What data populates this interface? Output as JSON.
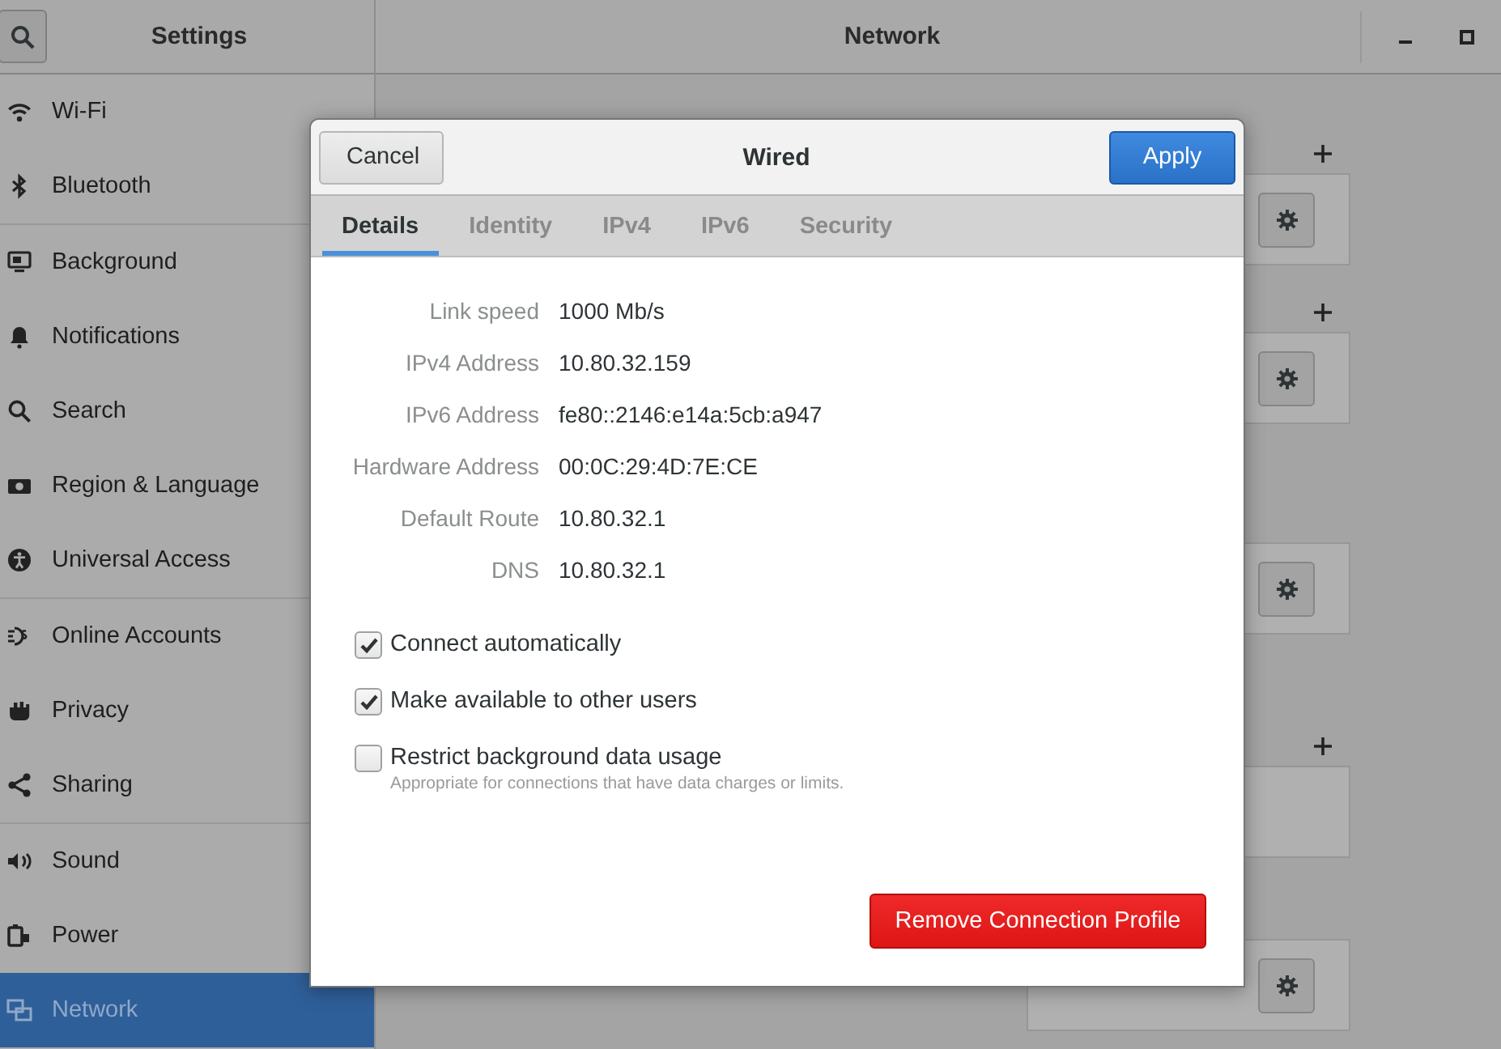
{
  "headerbar": {
    "title": "Settings",
    "page_title": "Network"
  },
  "sidebar": {
    "groups": [
      [
        {
          "label": "Wi-Fi",
          "selected": false
        },
        {
          "label": "Bluetooth",
          "selected": false
        }
      ],
      [
        {
          "label": "Background",
          "selected": false
        },
        {
          "label": "Notifications",
          "selected": false
        },
        {
          "label": "Search",
          "selected": false
        },
        {
          "label": "Region & Language",
          "selected": false
        },
        {
          "label": "Universal Access",
          "selected": false
        }
      ],
      [
        {
          "label": "Online Accounts",
          "selected": false
        },
        {
          "label": "Privacy",
          "selected": false
        },
        {
          "label": "Sharing",
          "selected": false
        }
      ],
      [
        {
          "label": "Sound",
          "selected": false
        },
        {
          "label": "Power",
          "selected": false
        },
        {
          "label": "Network",
          "selected": true
        }
      ]
    ]
  },
  "network_cards": [
    {
      "add_button": true,
      "settings_button": true
    },
    {
      "add_button": true,
      "settings_button": true
    },
    {
      "add_button": false,
      "settings_button": true
    },
    {
      "add_button": true,
      "settings_button": false
    },
    {
      "add_button": false,
      "settings_button": true
    }
  ],
  "dialog": {
    "title": "Wired",
    "cancel": "Cancel",
    "apply": "Apply",
    "tabs": [
      {
        "label": "Details",
        "selected": true
      },
      {
        "label": "Identity",
        "selected": false
      },
      {
        "label": "IPv4",
        "selected": false
      },
      {
        "label": "IPv6",
        "selected": false
      },
      {
        "label": "Security",
        "selected": false
      }
    ],
    "details": [
      {
        "label": "Link speed",
        "value": "1000 Mb/s"
      },
      {
        "label": "IPv4 Address",
        "value": "10.80.32.159"
      },
      {
        "label": "IPv6 Address",
        "value": "fe80::2146:e14a:5cb:a947"
      },
      {
        "label": "Hardware Address",
        "value": "00:0C:29:4D:7E:CE"
      },
      {
        "label": "Default Route",
        "value": "10.80.32.1"
      },
      {
        "label": "DNS",
        "value": "10.80.32.1"
      }
    ],
    "options": [
      {
        "label": "Connect automatically",
        "checked": true
      },
      {
        "label": "Make available to other users",
        "checked": true
      },
      {
        "label": "Restrict background data usage",
        "checked": false,
        "hint": "Appropriate for connections that have data charges or limits."
      }
    ],
    "remove_button": "Remove Connection Profile"
  }
}
